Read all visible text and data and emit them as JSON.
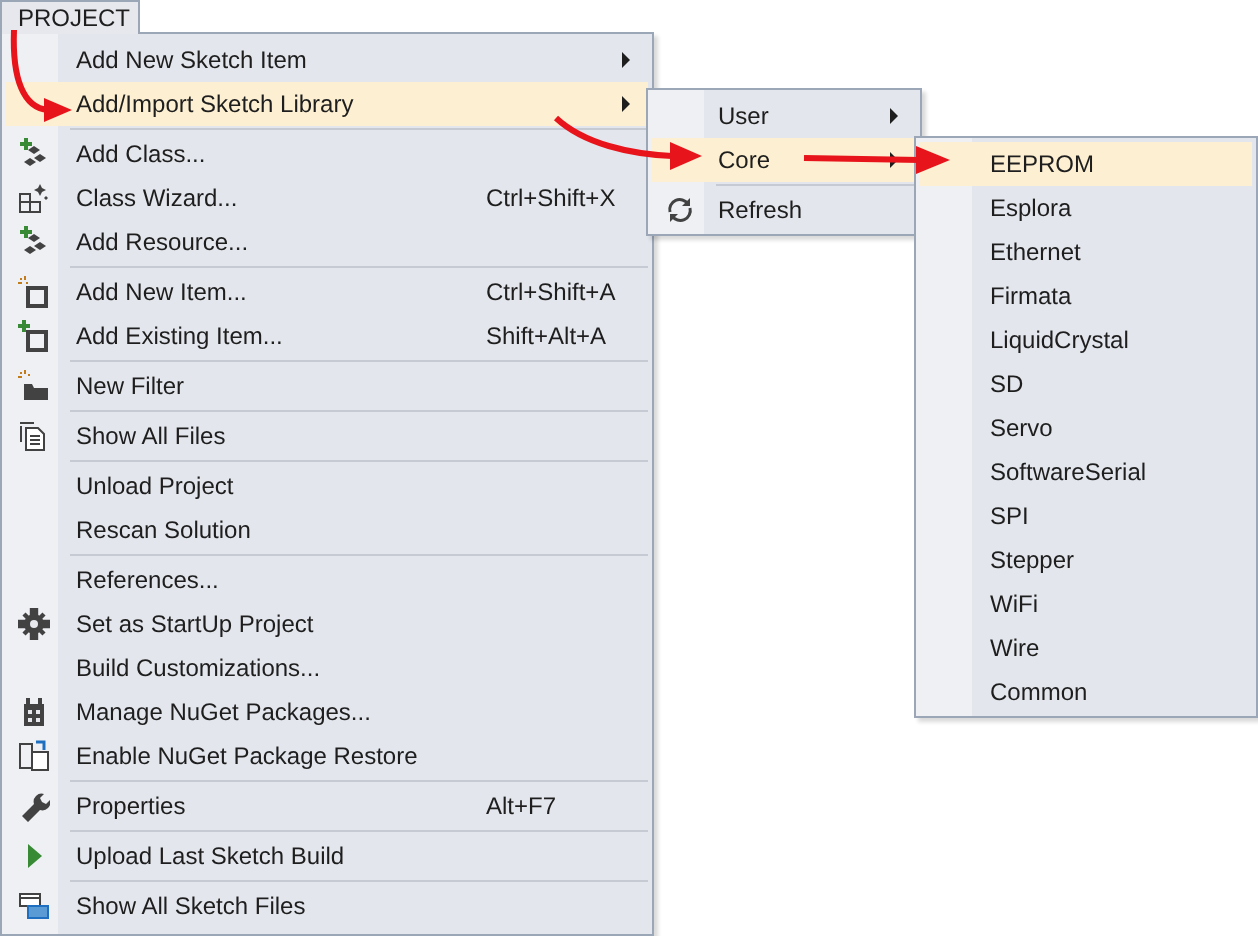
{
  "menu_bar": {
    "title": "PROJECT"
  },
  "menu": {
    "groups": [
      [
        {
          "label": "Add New Sketch Item",
          "has_submenu": true,
          "selected": false
        },
        {
          "label": "Add/Import Sketch Library",
          "has_submenu": true,
          "selected": true
        }
      ],
      [
        {
          "label": "Add Class...",
          "kind": "add-class",
          "selected": false
        },
        {
          "label": "Class Wizard...",
          "kind": "class-wizard",
          "shortcut": "Ctrl+Shift+X",
          "selected": false
        },
        {
          "label": "Add Resource...",
          "kind": "add-class",
          "selected": false
        }
      ],
      [
        {
          "label": "Add New Item...",
          "kind": "new-item",
          "shortcut": "Ctrl+Shift+A",
          "selected": false
        },
        {
          "label": "Add Existing Item...",
          "kind": "existing-item",
          "shortcut": "Shift+Alt+A",
          "selected": false
        }
      ],
      [
        {
          "label": "New Filter",
          "kind": "folder",
          "selected": false
        }
      ],
      [
        {
          "label": "Show All Files",
          "kind": "files",
          "selected": false
        }
      ],
      [
        {
          "label": "Unload Project",
          "selected": false
        },
        {
          "label": "Rescan Solution",
          "selected": false
        }
      ],
      [
        {
          "label": "References...",
          "selected": false
        },
        {
          "label": "Set as StartUp Project",
          "kind": "gear",
          "selected": false
        },
        {
          "label": "Build Customizations...",
          "selected": false
        },
        {
          "label": "Manage NuGet Packages...",
          "kind": "package",
          "selected": false
        },
        {
          "label": "Enable NuGet Package Restore",
          "kind": "restore",
          "selected": false
        }
      ],
      [
        {
          "label": "Properties",
          "kind": "wrench",
          "shortcut": "Alt+F7",
          "selected": false
        }
      ],
      [
        {
          "label": "Upload Last Sketch Build",
          "kind": "play",
          "selected": false
        }
      ],
      [
        {
          "label": "Show All Sketch Files",
          "kind": "windows",
          "selected": false
        }
      ]
    ]
  },
  "library_submenu": {
    "groups": [
      [
        {
          "label": "User",
          "has_submenu": true,
          "selected": false
        },
        {
          "label": "Core",
          "has_submenu": true,
          "selected": true
        }
      ],
      [
        {
          "label": "Refresh",
          "kind": "refresh",
          "selected": false
        }
      ]
    ]
  },
  "core_submenu": {
    "groups": [
      [
        {
          "label": "EEPROM",
          "selected": true
        },
        {
          "label": "Esplora",
          "selected": false
        },
        {
          "label": "Ethernet",
          "selected": false
        },
        {
          "label": "Firmata",
          "selected": false
        },
        {
          "label": "LiquidCrystal",
          "selected": false
        },
        {
          "label": "SD",
          "selected": false
        },
        {
          "label": "Servo",
          "selected": false
        },
        {
          "label": "SoftwareSerial",
          "selected": false
        },
        {
          "label": "SPI",
          "selected": false
        },
        {
          "label": "Stepper",
          "selected": false
        },
        {
          "label": "WiFi",
          "selected": false
        },
        {
          "label": "Wire",
          "selected": false
        },
        {
          "label": "Common",
          "selected": false
        }
      ]
    ]
  }
}
